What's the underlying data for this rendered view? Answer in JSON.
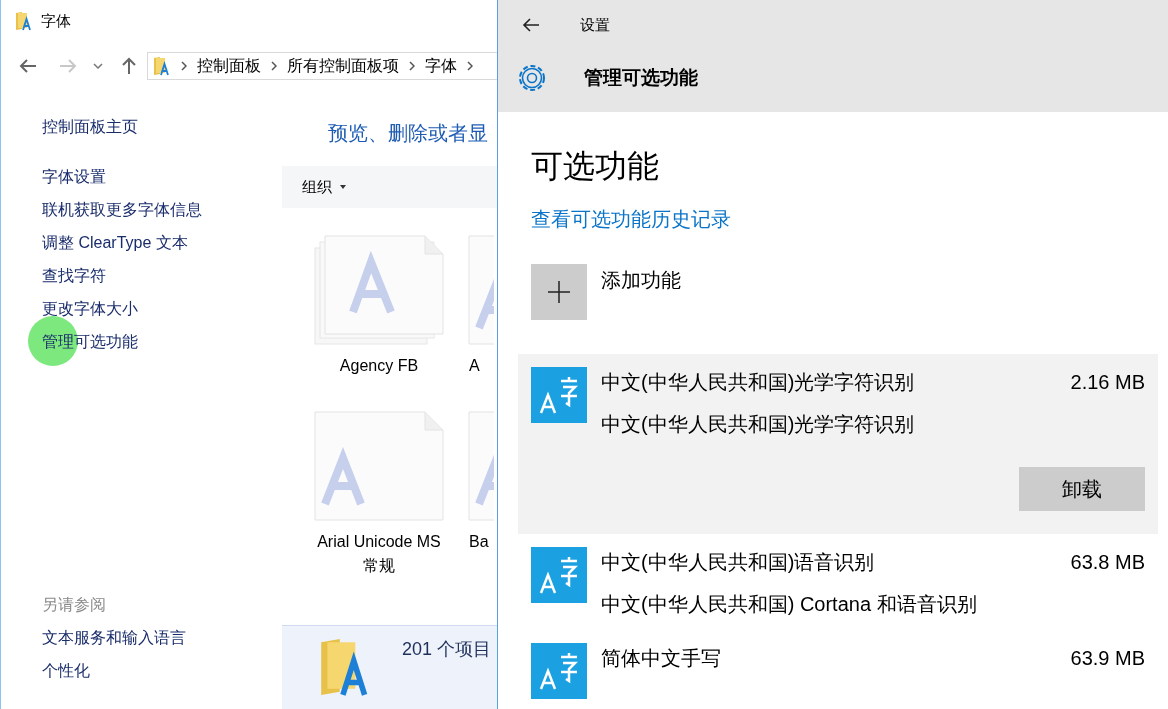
{
  "explorer": {
    "title": "字体",
    "path": [
      "控制面板",
      "所有控制面板项",
      "字体"
    ],
    "sidebar": {
      "items": [
        {
          "label": "控制面板主页",
          "highlighted": false
        },
        {
          "label": "字体设置",
          "highlighted": false
        },
        {
          "label": "联机获取更多字体信息",
          "highlighted": false
        },
        {
          "label": "调整 ClearType 文本",
          "highlighted": false
        },
        {
          "label": "查找字符",
          "highlighted": false
        },
        {
          "label": "更改字体大小",
          "highlighted": false
        },
        {
          "label": "管理可选功能",
          "highlighted": true
        }
      ],
      "see_also_title": "另请参阅",
      "see_also": [
        "文本服务和输入语言",
        "个性化"
      ]
    },
    "heading": "预览、删除或者显",
    "toolbar": {
      "organize": "组织"
    },
    "fonts": [
      {
        "name": "Agency FB",
        "stacked": true
      },
      {
        "name": "A",
        "stacked": false
      },
      {
        "name": "Arial Unicode MS 常规",
        "stacked": false
      },
      {
        "name": "Ba",
        "stacked": false
      }
    ],
    "status": "201 个项目"
  },
  "settings": {
    "title": "设置",
    "page_title": "管理可选功能",
    "heading": "可选功能",
    "history_link": "查看可选功能历史记录",
    "add_feature": "添加功能",
    "features": [
      {
        "name": "中文(中华人民共和国)光学字符识别",
        "description": "中文(中华人民共和国)光学字符识别",
        "size": "2.16 MB",
        "expanded": true,
        "button": "卸载"
      },
      {
        "name": "中文(中华人民共和国)语音识别",
        "description": "中文(中华人民共和国) Cortana 和语音识别",
        "size": "63.8 MB",
        "expanded": false
      },
      {
        "name": "简体中文手写",
        "size": "63.9 MB",
        "expanded": false
      }
    ]
  }
}
